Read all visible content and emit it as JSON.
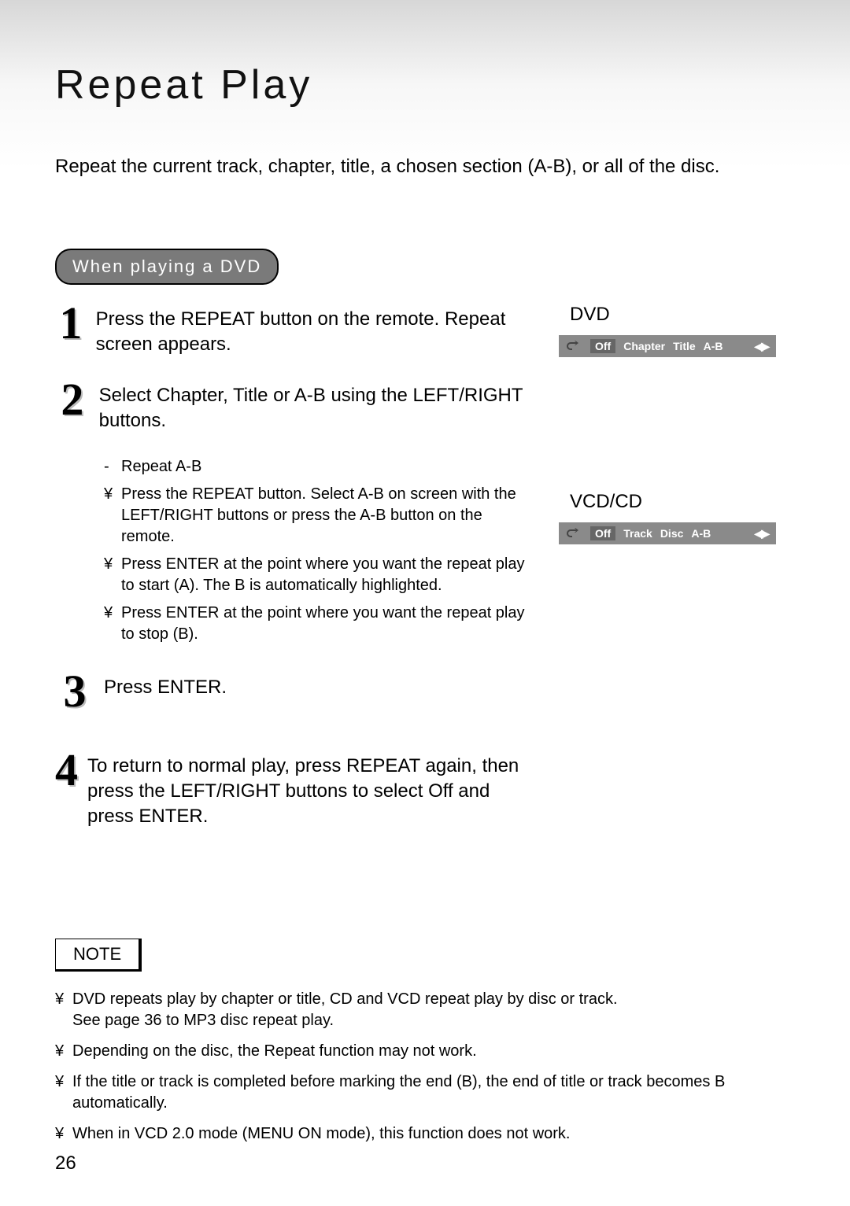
{
  "title": "Repeat Play",
  "intro": "Repeat the current track, chapter, title, a chosen section (A-B), or all of the disc.",
  "pill": "When playing a DVD",
  "steps": {
    "s1": {
      "num": "1",
      "text": "Press the REPEAT button on the remote. Repeat screen appears."
    },
    "s2": {
      "num": "2",
      "text": "Select Chapter, Title or A-B using the LEFT/RIGHT buttons."
    },
    "s3": {
      "num": "3",
      "text": "Press ENTER."
    },
    "s4": {
      "num": "4",
      "text": "To return to normal play, press REPEAT again, then press the LEFT/RIGHT buttons to select Off and press ENTER."
    }
  },
  "sub": {
    "a": {
      "mark": "-",
      "text": "Repeat A-B"
    },
    "b": {
      "mark": "¥",
      "text": "Press the REPEAT button. Select A-B on screen with the LEFT/RIGHT buttons or press the A-B button on the remote."
    },
    "c": {
      "mark": "¥",
      "text": "Press ENTER at the point where you want the repeat play to start (A). The B is automatically highlighted."
    },
    "d": {
      "mark": "¥",
      "text": "Press ENTER at the point where you want the repeat play to stop (B)."
    }
  },
  "osd": {
    "dvd": {
      "label": "DVD",
      "items": {
        "off": "Off",
        "a": "Chapter",
        "b": "Title",
        "c": "A-B"
      }
    },
    "vcd": {
      "label": "VCD/CD",
      "items": {
        "off": "Off",
        "a": "Track",
        "b": "Disc",
        "c": "A-B"
      }
    },
    "arrows": "◀▶"
  },
  "noteHeader": "NOTE",
  "notes": {
    "n1a": "DVD repeats play by chapter or title, CD and VCD repeat play by disc or track.",
    "n1b": "See page 36 to MP3 disc repeat play.",
    "n2": "Depending on the disc, the Repeat function may not work.",
    "n3": "If the title or track is completed before marking the end (B), the end of title or track becomes B automatically.",
    "n4": "When in VCD 2.0 mode (MENU ON mode), this function does not work."
  },
  "noteMark": "¥",
  "pageNumber": "26"
}
